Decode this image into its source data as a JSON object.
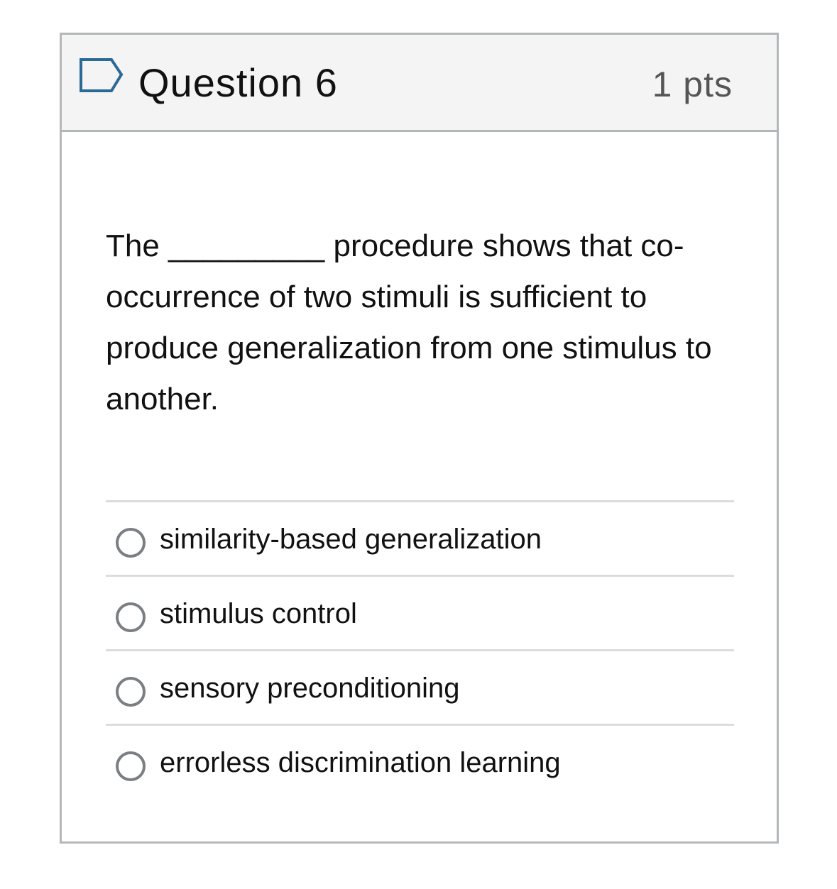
{
  "question": {
    "title": "Question 6",
    "points": "1 pts",
    "flag_icon": "flag-outline-icon",
    "text": "The _________ procedure shows that co-occurrence of two stimuli is sufficient to produce generalization from one stimulus to another."
  },
  "answers": [
    {
      "label": "similarity-based generalization",
      "selected": false
    },
    {
      "label": "stimulus control",
      "selected": false
    },
    {
      "label": "sensory preconditioning",
      "selected": false
    },
    {
      "label": "errorless discrimination learning",
      "selected": false
    }
  ],
  "colors": {
    "header_bg": "#f4f4f4",
    "border": "#b4b7b9",
    "flag": "#2b6a96",
    "radio": "#7b7f83"
  }
}
